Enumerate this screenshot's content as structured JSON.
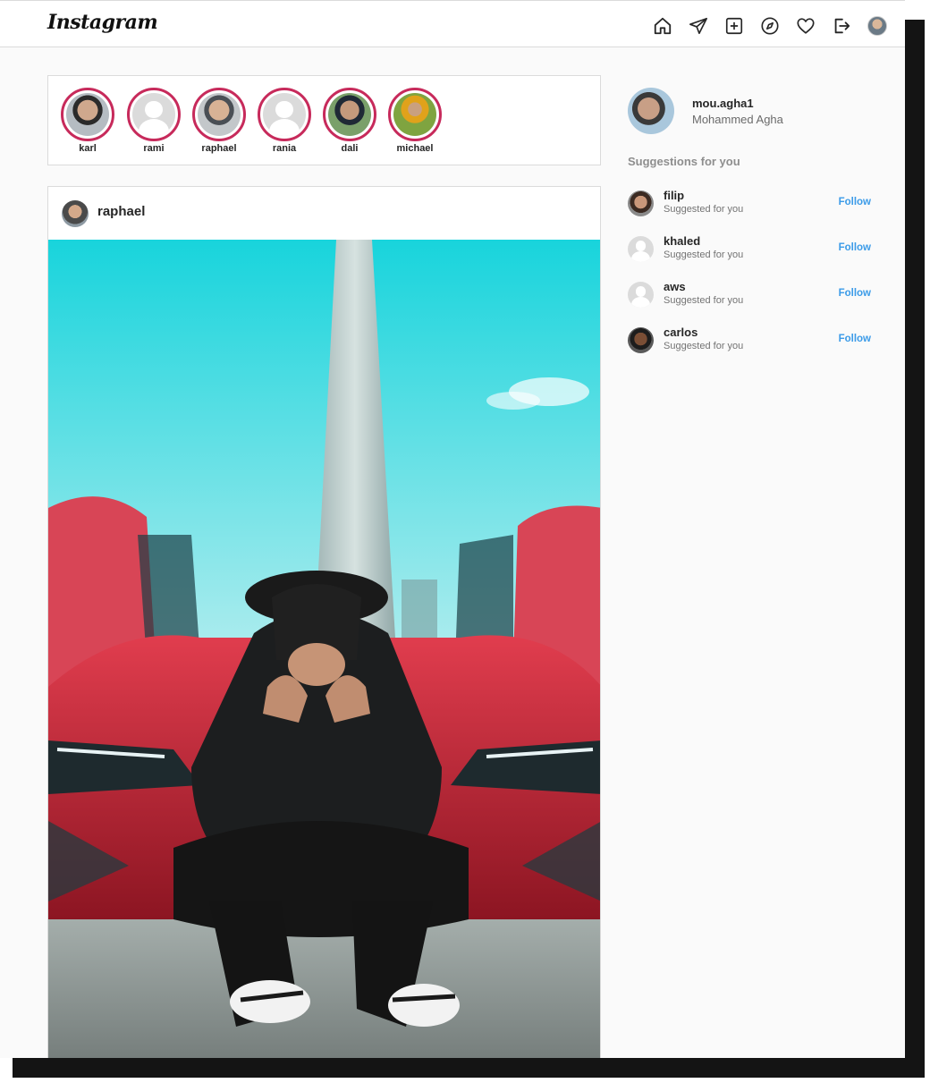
{
  "header": {
    "logo": "Instagram",
    "nav": [
      "home-icon",
      "direct-message-icon",
      "new-post-icon",
      "explore-icon",
      "activity-heart-icon",
      "logout-icon",
      "profile-avatar"
    ]
  },
  "stories": [
    {
      "name": "karl",
      "photo": true
    },
    {
      "name": "rami",
      "photo": false
    },
    {
      "name": "raphael",
      "photo": true
    },
    {
      "name": "rania",
      "photo": false
    },
    {
      "name": "dali",
      "photo": true
    },
    {
      "name": "michael",
      "photo": true
    }
  ],
  "post": {
    "username": "raphael"
  },
  "profile": {
    "username": "mou.agha1",
    "full_name": "Mohammed Agha"
  },
  "suggestions": {
    "title": "Suggestions for you",
    "items": [
      {
        "username": "filip",
        "subtitle": "Suggested for you",
        "action": "Follow"
      },
      {
        "username": "khaled",
        "subtitle": "Suggested for you",
        "action": "Follow"
      },
      {
        "username": "aws",
        "subtitle": "Suggested for you",
        "action": "Follow"
      },
      {
        "username": "carlos",
        "subtitle": "Suggested for you",
        "action": "Follow"
      }
    ]
  },
  "colors": {
    "story_ring": "#c72a5b",
    "follow_link": "#3b9be8",
    "background": "#fafafa"
  }
}
